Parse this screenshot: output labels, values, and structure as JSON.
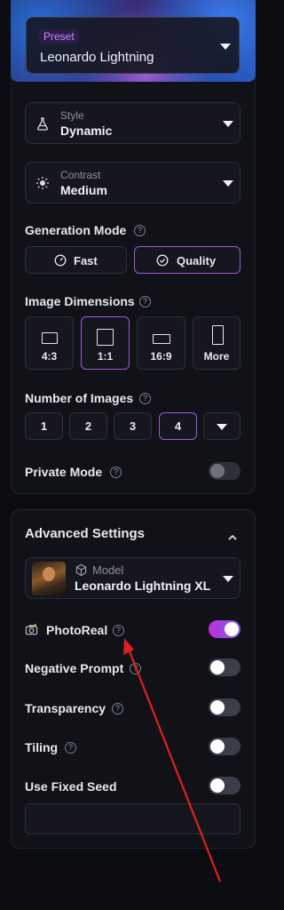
{
  "preset": {
    "tag": "Preset",
    "value": "Leonardo Lightning"
  },
  "style": {
    "label": "Style",
    "value": "Dynamic",
    "icon": "flask-icon"
  },
  "contrast": {
    "label": "Contrast",
    "value": "Medium",
    "icon": "sun-icon"
  },
  "generation_mode": {
    "title": "Generation Mode",
    "options": [
      {
        "label": "Fast",
        "icon": "speedometer-icon",
        "selected": false
      },
      {
        "label": "Quality",
        "icon": "check-circle-icon",
        "selected": true
      }
    ]
  },
  "image_dimensions": {
    "title": "Image Dimensions",
    "options": [
      {
        "label": "4:3",
        "selected": false
      },
      {
        "label": "1:1",
        "selected": true
      },
      {
        "label": "16:9",
        "selected": false
      },
      {
        "label": "More",
        "selected": false
      }
    ]
  },
  "number_of_images": {
    "title": "Number of Images",
    "options": [
      "1",
      "2",
      "3",
      "4"
    ],
    "selected": "4"
  },
  "private_mode": {
    "label": "Private Mode",
    "enabled": false
  },
  "advanced": {
    "title": "Advanced Settings",
    "model": {
      "label": "Model",
      "value": "Leonardo Lightning XL"
    },
    "photoreal": {
      "label": "PhotoReal",
      "enabled": true
    },
    "negative_prompt": {
      "label": "Negative Prompt",
      "enabled": false
    },
    "transparency": {
      "label": "Transparency",
      "enabled": false
    },
    "tiling": {
      "label": "Tiling",
      "enabled": false
    },
    "fixed_seed": {
      "label": "Use Fixed Seed",
      "enabled": false,
      "value": ""
    }
  },
  "colors": {
    "accent": "#9b5cd6",
    "toggle_on_start": "#c02fd8",
    "toggle_on_end": "#7d5cf0",
    "annotation_arrow": "#e0201c"
  }
}
